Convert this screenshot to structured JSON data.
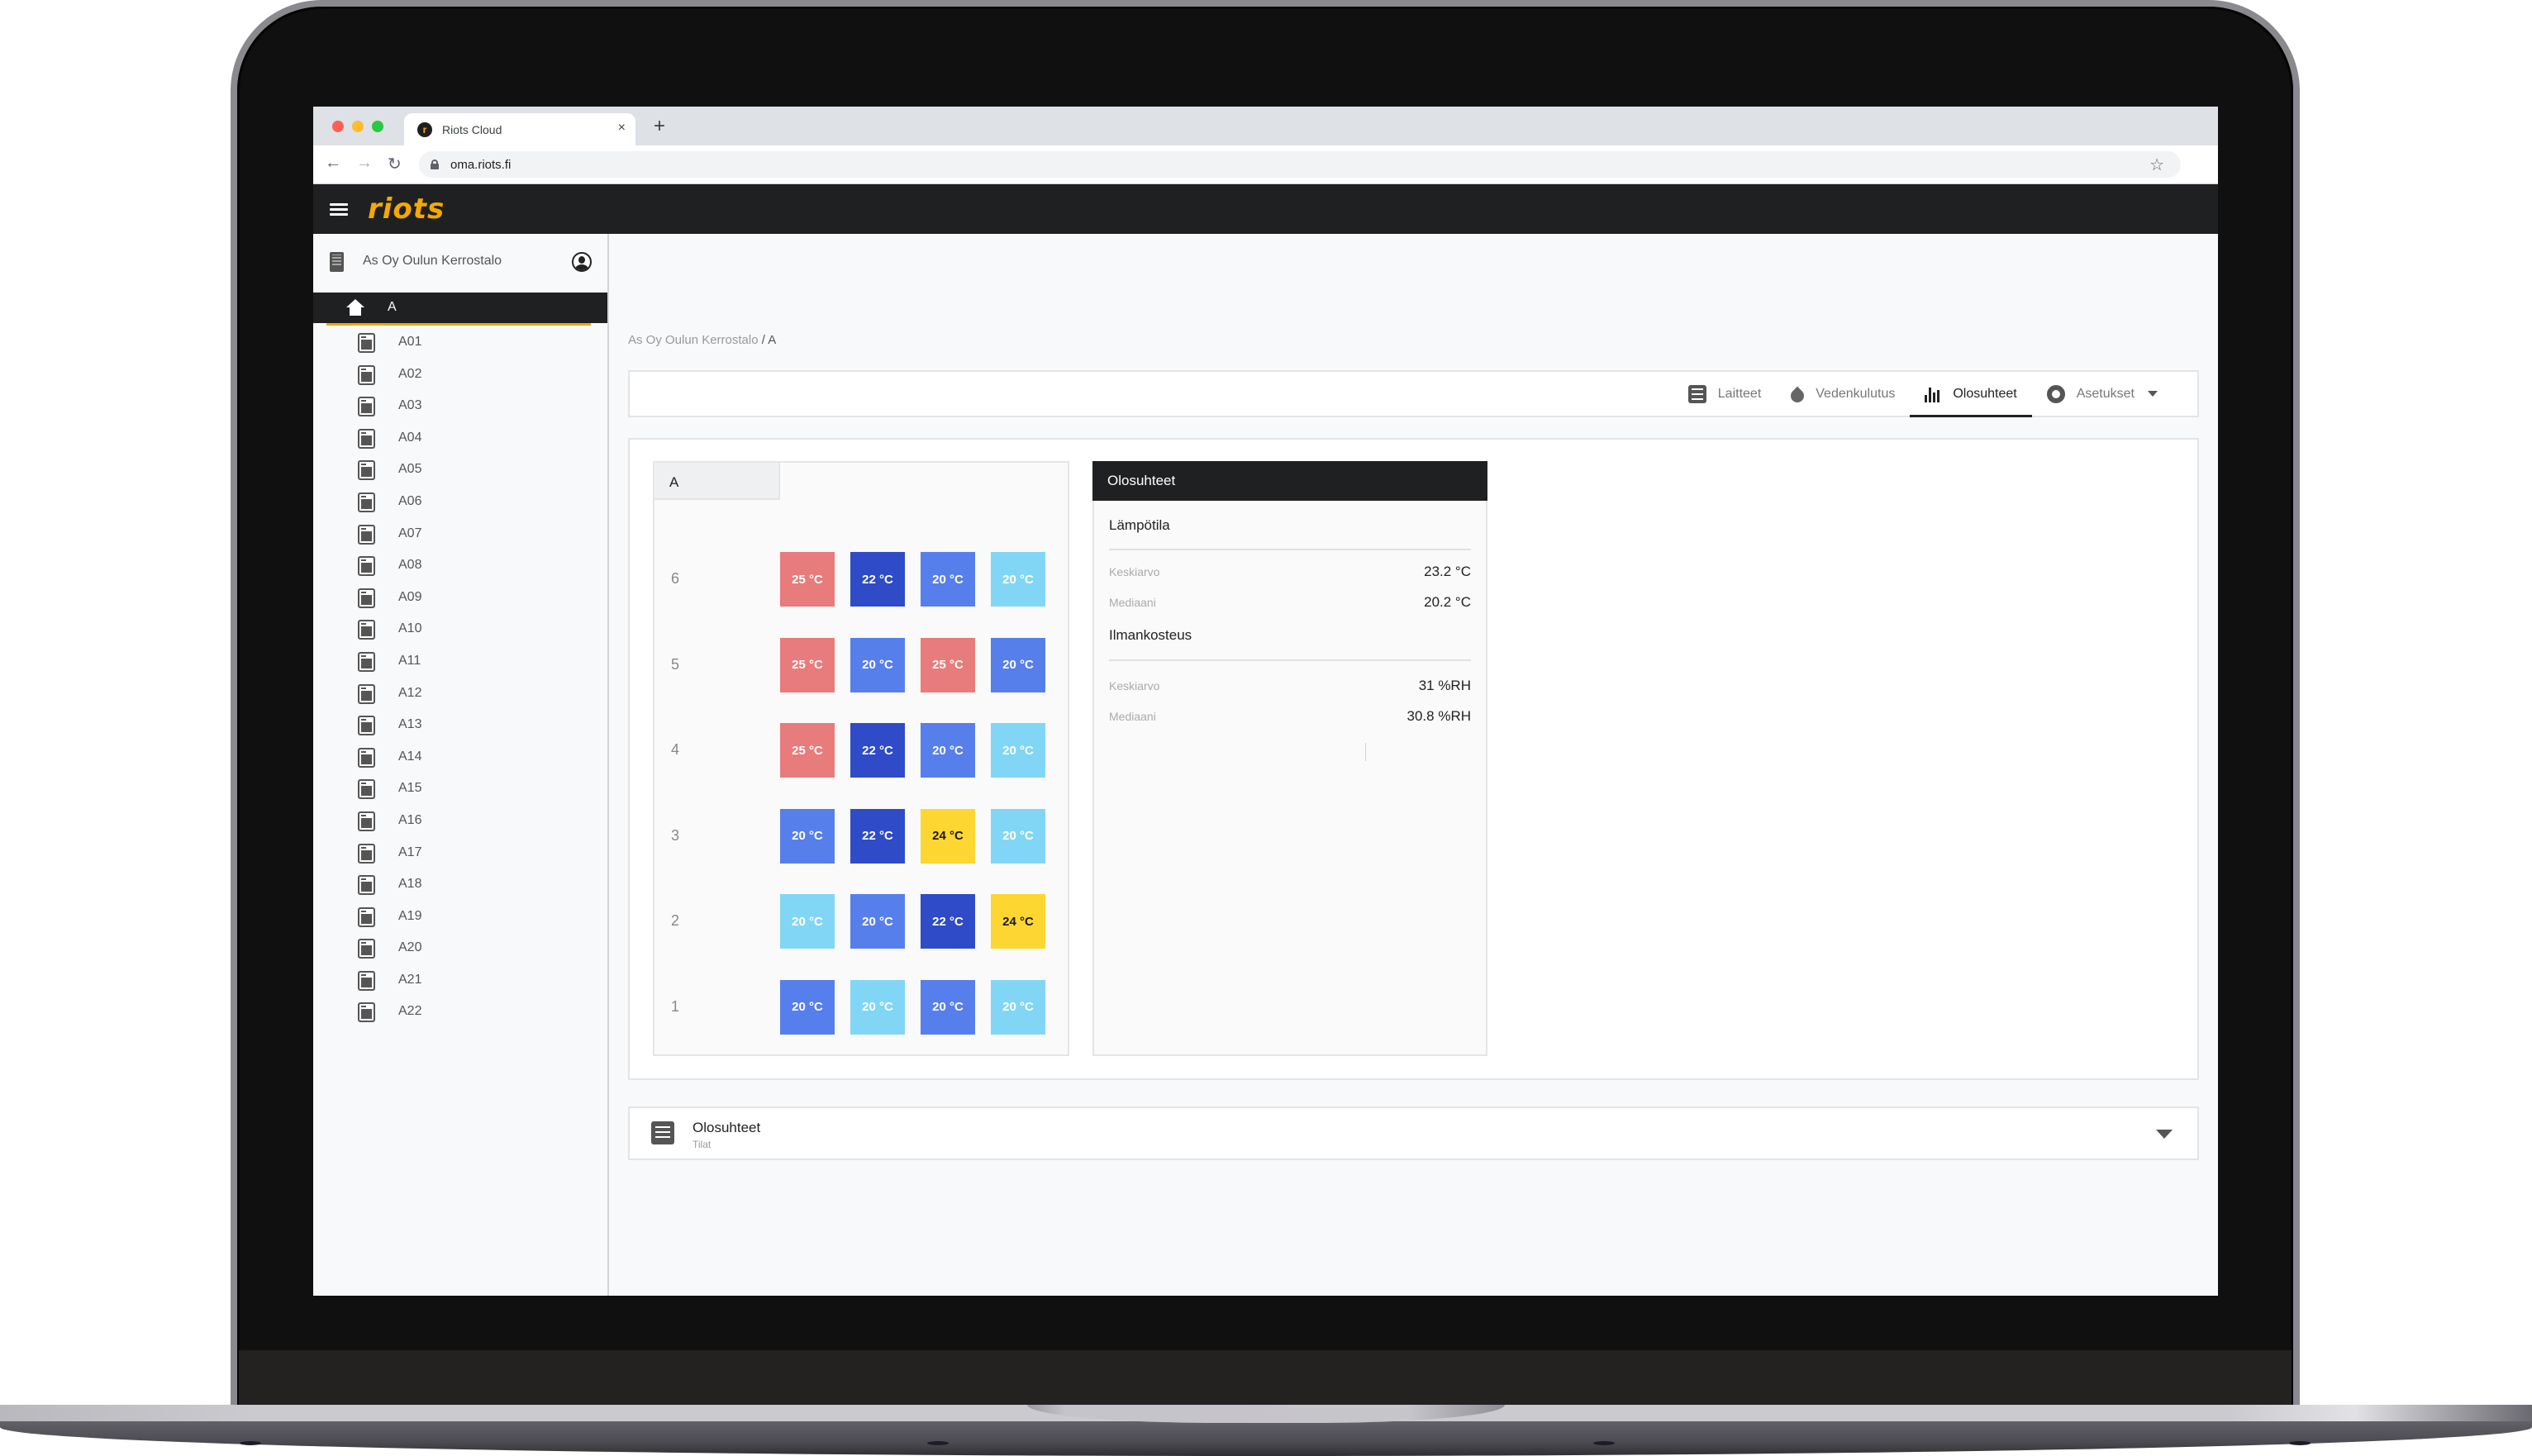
{
  "browser": {
    "tab_title": "Riots Cloud",
    "favicon_letter": "r",
    "tab_close": "×",
    "new_tab": "+",
    "url": "oma.riots.fi",
    "back": "←",
    "forward": "→",
    "reload": "↻",
    "bookmark": "☆",
    "traffic_lights": [
      "#ff5f57",
      "#febc2e",
      "#28c840"
    ]
  },
  "app": {
    "logo": "riots",
    "brand_color": "#f5a800"
  },
  "sidebar": {
    "property": "As Oy Oulun Kerrostalo",
    "selected": "A",
    "items": [
      "A01",
      "A02",
      "A03",
      "A04",
      "A05",
      "A06",
      "A07",
      "A08",
      "A09",
      "A10",
      "A11",
      "A12",
      "A13",
      "A14",
      "A15",
      "A16",
      "A17",
      "A18",
      "A19",
      "A20",
      "A21",
      "A22"
    ]
  },
  "breadcrumb": {
    "parent": "As Oy Oulun Kerrostalo",
    "separator": " / ",
    "current": "A"
  },
  "nav_tabs": [
    {
      "label": "Laitteet",
      "icon": "list-icon",
      "active": false
    },
    {
      "label": "Vedenkulutus",
      "icon": "water-drop-icon",
      "active": false
    },
    {
      "label": "Olosuhteet",
      "icon": "bar-chart-icon",
      "active": true
    },
    {
      "label": "Asetukset",
      "icon": "gear-icon",
      "active": false,
      "dropdown": true
    }
  ],
  "grid": {
    "building": "A",
    "colors": {
      "20_light": "#82d6f5",
      "20": "#577feb",
      "22": "#2f4bc7",
      "24": "#fdd632",
      "25": "#e87b7b"
    },
    "floors": [
      {
        "floor": "6",
        "rooms": [
          {
            "value": "25 °C",
            "tone": "25"
          },
          {
            "value": "22 °C",
            "tone": "22"
          },
          {
            "value": "20 °C",
            "tone": "20"
          },
          {
            "value": "20 °C",
            "tone": "20_light"
          }
        ]
      },
      {
        "floor": "5",
        "rooms": [
          {
            "value": "25 °C",
            "tone": "25"
          },
          {
            "value": "20 °C",
            "tone": "20"
          },
          {
            "value": "25 °C",
            "tone": "25"
          },
          {
            "value": "20 °C",
            "tone": "20"
          }
        ]
      },
      {
        "floor": "4",
        "rooms": [
          {
            "value": "25 °C",
            "tone": "25"
          },
          {
            "value": "22 °C",
            "tone": "22"
          },
          {
            "value": "20 °C",
            "tone": "20"
          },
          {
            "value": "20 °C",
            "tone": "20_light"
          }
        ]
      },
      {
        "floor": "3",
        "rooms": [
          {
            "value": "20 °C",
            "tone": "20"
          },
          {
            "value": "22 °C",
            "tone": "22"
          },
          {
            "value": "24 °C",
            "tone": "24"
          },
          {
            "value": "20 °C",
            "tone": "20_light"
          }
        ]
      },
      {
        "floor": "2",
        "rooms": [
          {
            "value": "20 °C",
            "tone": "20_light"
          },
          {
            "value": "20 °C",
            "tone": "20"
          },
          {
            "value": "22 °C",
            "tone": "22"
          },
          {
            "value": "24 °C",
            "tone": "24"
          }
        ]
      },
      {
        "floor": "1",
        "rooms": [
          {
            "value": "20 °C",
            "tone": "20"
          },
          {
            "value": "20 °C",
            "tone": "20_light"
          },
          {
            "value": "20 °C",
            "tone": "20"
          },
          {
            "value": "20 °C",
            "tone": "20_light"
          }
        ]
      }
    ]
  },
  "stats": {
    "title": "Olosuhteet",
    "temperature": {
      "heading": "Lämpötila",
      "mean_label": "Keskiarvo",
      "mean_value": "23.2 °C",
      "median_label": "Mediaani",
      "median_value": "20.2 °C"
    },
    "humidity": {
      "heading": "Ilmankosteus",
      "mean_label": "Keskiarvo",
      "mean_value": "31 %RH",
      "median_label": "Mediaani",
      "median_value": "30.8 %RH"
    }
  },
  "collapse": {
    "title": "Olosuhteet",
    "subtitle": "Tilat"
  }
}
